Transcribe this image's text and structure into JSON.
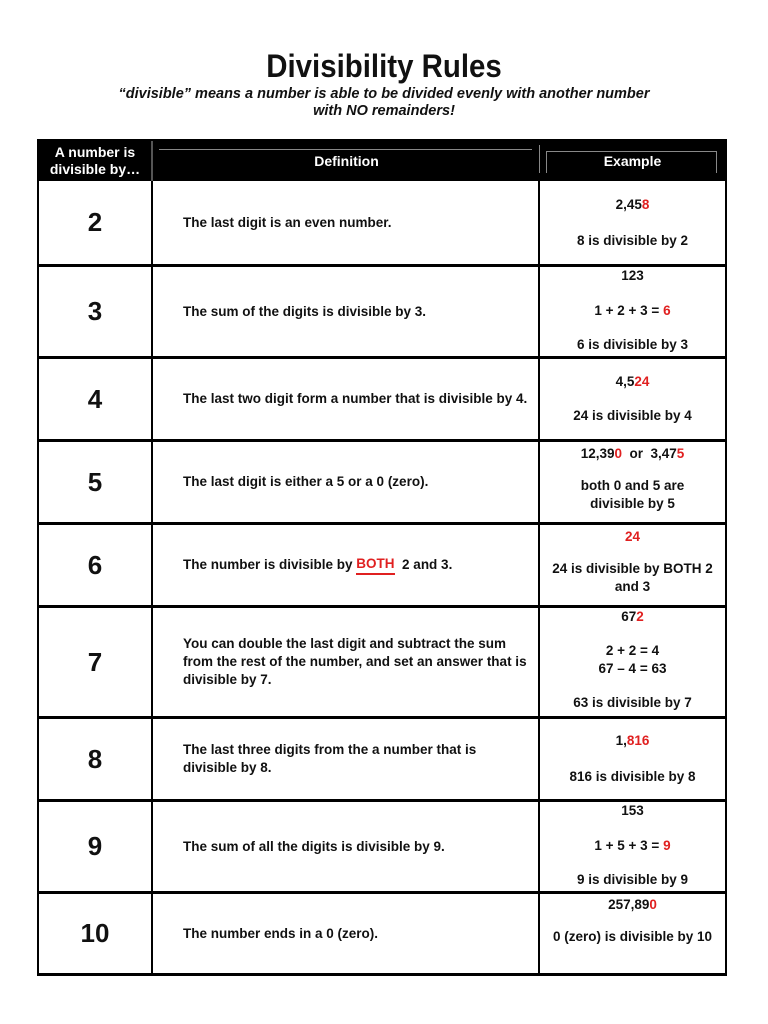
{
  "header": {
    "title": "Divisibility Rules",
    "subtitle_line1": "“divisible” means a number is able to be divided evenly with another number",
    "subtitle_line2": "with NO remainders!"
  },
  "table": {
    "columns": {
      "number": "A number is divisible by…",
      "definition": "Definition",
      "example": "Example"
    },
    "colors": {
      "highlight": "#e02020",
      "header_bg": "#000000"
    },
    "rows": [
      {
        "number": "2",
        "definition": "The last digit is an even number.",
        "example": {
          "top_black": "2,45",
          "top_red": "8",
          "line2": "8 is divisible by 2"
        }
      },
      {
        "number": "3",
        "definition": "The sum of the digits is divisible by 3.",
        "example": {
          "top": "123",
          "mid_black": "1 + 2 + 3 = ",
          "mid_red": "6",
          "bottom": "6 is divisible by 3"
        }
      },
      {
        "number": "4",
        "definition": "The last two digit form a number that is divisible by 4.",
        "example": {
          "top_black": "4,5",
          "top_red": "24",
          "line2": "24 is divisible by 4"
        }
      },
      {
        "number": "5",
        "definition": "The last digit is either a  5 or a  0 (zero).",
        "example": {
          "a_black": "12,39",
          "a_red": "0",
          "or": "  or  ",
          "b_black": "3,47",
          "b_red": "5",
          "line2": "both 0 and 5 are divisible by 5"
        }
      },
      {
        "number": "6",
        "definition_before": "The number is divisible by ",
        "definition_emphasis": "BOTH",
        "definition_after": "  2 and 3.",
        "example": {
          "top_red": "24",
          "line2": "24 is divisible by BOTH 2 and 3"
        }
      },
      {
        "number": "7",
        "definition": "You can double the last digit and subtract the sum from the rest of the number, and set an answer that is divisible by 7.",
        "example": {
          "top_black": "67",
          "top_red": "2",
          "mid1": "2 + 2 = 4",
          "mid2": "67 – 4 = 63",
          "bottom": "63 is divisible by 7"
        }
      },
      {
        "number": "8",
        "definition": "The last three digits from the a number that is divisible by  8.",
        "example": {
          "top_black": "1,",
          "top_red": "816",
          "line2": "816 is divisible by 8"
        }
      },
      {
        "number": "9",
        "definition": "The sum of all the digits is divisible by  9.",
        "example": {
          "top": "153",
          "mid_black": "1 + 5 + 3 = ",
          "mid_red": "9",
          "bottom": "9 is divisible by 9"
        }
      },
      {
        "number": "10",
        "definition": "The number ends in a 0 (zero).",
        "example": {
          "top_black": "257,89",
          "top_red": "0",
          "line2": "0 (zero) is divisible by 10"
        }
      }
    ]
  }
}
